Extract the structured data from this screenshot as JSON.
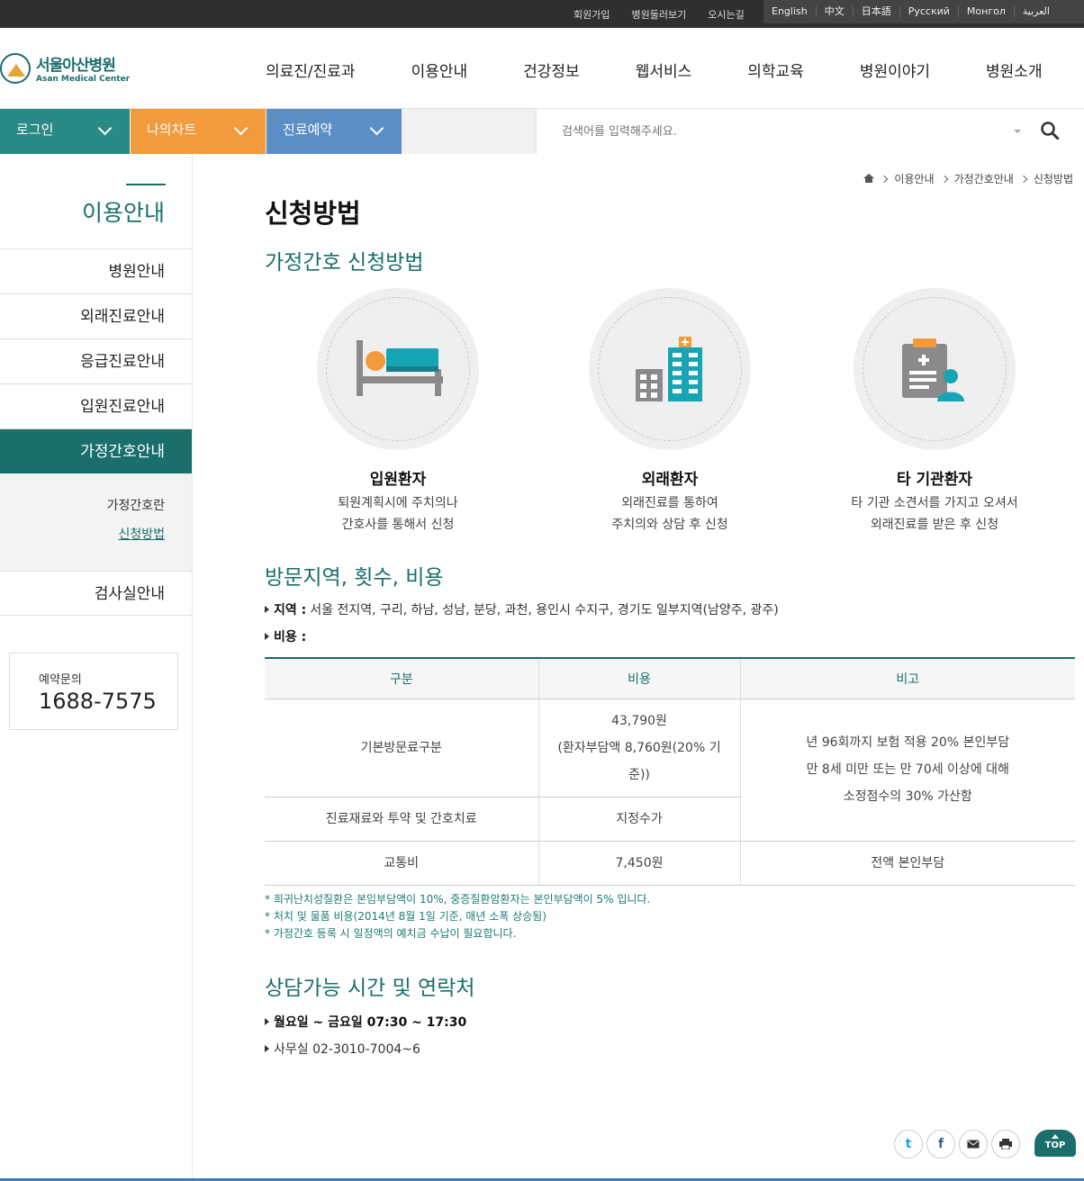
{
  "topbar": {
    "utils": [
      "회원가입",
      "병원둘러보기",
      "오시는길"
    ],
    "langs": [
      "English",
      "中文",
      "日本語",
      "Русский",
      "Монгол",
      "العربية"
    ]
  },
  "logo": {
    "ko": "서울아산병원",
    "en": "Asan Medical Center"
  },
  "gnb": [
    "의료진/진료과",
    "이용안내",
    "건강정보",
    "웹서비스",
    "의학교육",
    "병원이야기",
    "병원소개"
  ],
  "quick": {
    "login": "로그인",
    "mychart": "나의차트",
    "reserve": "진료예약",
    "search_placeholder": "검색어를 입력해주세요.",
    "colors": {
      "login": "#2a8a86",
      "mychart": "#f39a3d",
      "reserve": "#5b8ec4"
    }
  },
  "sidebar": {
    "title": "이용안내",
    "items": [
      "병원안내",
      "외래진료안내",
      "응급진료안내",
      "입원진료안내",
      "가정간호안내",
      "검사실안내"
    ],
    "sub": [
      "가정간호란",
      "신청방법"
    ],
    "call_label": "예약문의",
    "call_number": "1688-7575"
  },
  "breadcrumb": [
    "이용안내",
    "가정간호안내",
    "신청방법"
  ],
  "page_title": "신청방법",
  "sections": {
    "apply": "가정간호 신청방법",
    "visit": "방문지역, 횟수, 비용",
    "contact": "상담가능 시간 및 연락처"
  },
  "cards": [
    {
      "icon": "hospital-bed-icon",
      "title": "입원환자",
      "line1": "퇴원계획시에 주치의나",
      "line2": "간호사를 통해서 신청"
    },
    {
      "icon": "hospital-building-icon",
      "title": "외래환자",
      "line1": "외래진료를 통하여",
      "line2": "주치의와 상담 후 신청"
    },
    {
      "icon": "clipboard-doctor-icon",
      "title": "타 기관환자",
      "line1": "타 기관 소견서를 가지고 오셔서",
      "line2": "외래진료를 받은 후 신청"
    }
  ],
  "region": {
    "label": "지역 :",
    "value": "서울 전지역, 구리, 하남, 성남, 분당, 과천, 용인시 수지구, 경기도 일부지역(남양주, 광주)"
  },
  "cost_label": "비용 :",
  "table": {
    "headers": [
      "구분",
      "비용",
      "비고"
    ],
    "row1": {
      "c1": "기본방문료구분",
      "c2a": "43,790원",
      "c2b": "(환자부담액 8,760원(20% 기",
      "c2c": "준))",
      "c3a": "년 96회까지 보험 적용 20% 본인부담",
      "c3b": "만 8세 미만 또는 만 70세 이상에 대해",
      "c3c": "소정점수의 30% 가산함"
    },
    "row2": {
      "c1": "진료재료와 투약 및 간호치료",
      "c2": "지정수가"
    },
    "row3": {
      "c1": "교통비",
      "c2": "7,450원",
      "c3": "전액 본인부담"
    }
  },
  "notes": [
    "* 희귀난치성질환은 본임부담액이 10%, 중증질환암환자는 본인부담액이 5% 입니다.",
    "* 처치 및 물품 비용(2014년 8월 1일 기준, 매년 소폭 상승됨)",
    "* 가정간호 등록 시 일정액의 예치금 수납이 필요합니다."
  ],
  "contact": {
    "hours": "월요일 ~ 금요일 07:30 ~ 17:30",
    "phone": "사무실 02-3010-7004~6"
  },
  "top_label": "TOP",
  "accent": "#1a6f6d"
}
